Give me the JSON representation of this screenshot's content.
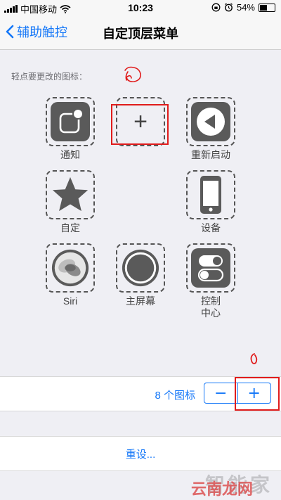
{
  "status_bar": {
    "carrier": "中国移动",
    "time": "10:23",
    "battery": "54%",
    "battery_level": 0.54
  },
  "nav": {
    "back_label": "辅助触控",
    "title": "自定顶层菜单"
  },
  "hint": "轻点要更改的图标：",
  "tiles": {
    "notification": "通知",
    "empty_slot_symbol": "+",
    "restart": "重新启动",
    "custom": "自定",
    "device": "设备",
    "siri": "Siri",
    "home": "主屏幕",
    "control_center_line1": "控制",
    "control_center_line2": "中心"
  },
  "count": {
    "label": "8 个图标",
    "minus": "−",
    "plus": "+"
  },
  "reset": "重设...",
  "watermark": {
    "text1": "智能家",
    "text2": "云南龙网"
  },
  "colors": {
    "accent": "#1477f8",
    "annotation": "#e01b1b",
    "icon_bg": "#5a5a5a"
  }
}
